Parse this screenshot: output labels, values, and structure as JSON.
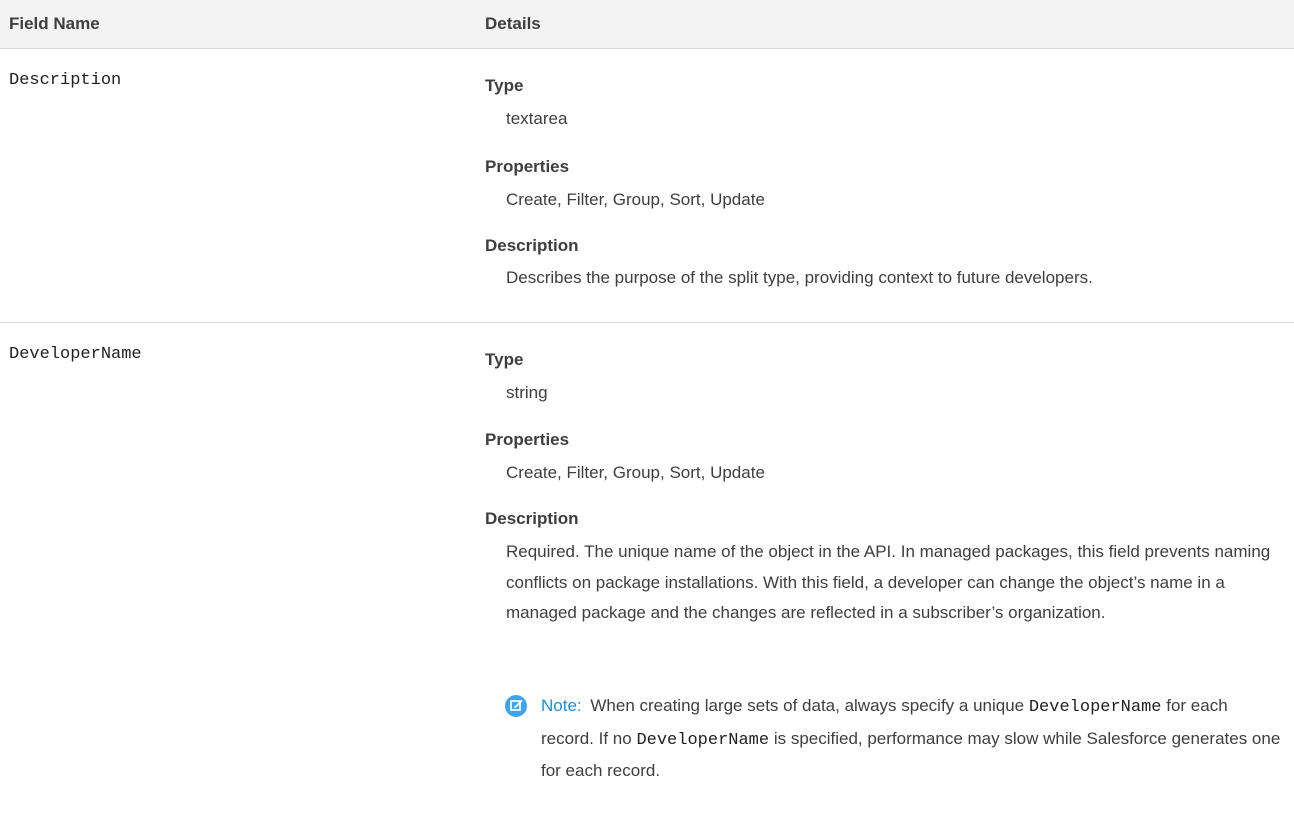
{
  "table": {
    "headers": {
      "field_name": "Field Name",
      "details": "Details"
    },
    "rows": [
      {
        "field_name": "Description",
        "type_label": "Type",
        "type_value": "textarea",
        "properties_label": "Properties",
        "properties_value": "Create, Filter, Group, Sort, Update",
        "description_label": "Description",
        "description_value": "Describes the purpose of the split type, providing context to future developers."
      },
      {
        "field_name": "DeveloperName",
        "type_label": "Type",
        "type_value": "string",
        "properties_label": "Properties",
        "properties_value": "Create, Filter, Group, Sort, Update",
        "description_label": "Description",
        "description_value": "Required. The unique name of the object in the API. In managed packages, this field prevents naming conflicts on package installations. With this field, a developer can change the object’s name in a managed package and the changes are reflected in a subscriber’s organization.",
        "note": {
          "icon": "edit-note-icon",
          "label": "Note:",
          "text_1": "When creating large sets of data, always specify a unique",
          "code_1": "DeveloperName",
          "text_2": "for each record. If no",
          "code_2": "DeveloperName",
          "text_3": "is specified, performance may slow while Salesforce generates one for each record."
        }
      }
    ]
  }
}
